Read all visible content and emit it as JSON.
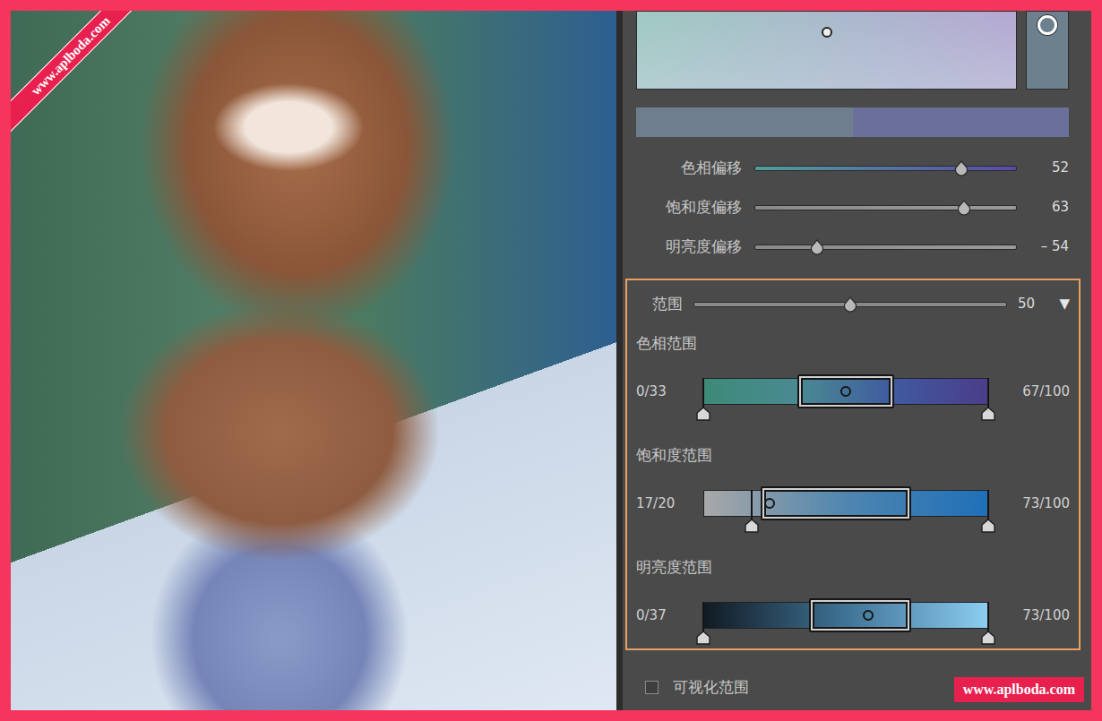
{
  "watermarks": [
    "www.aplboda.com",
    "www.aplboda.com"
  ],
  "color_picker": {
    "x": 0.5,
    "y": 0.27,
    "side_level": 0.18
  },
  "swatches": [
    {
      "color": "#6e7e8e"
    },
    {
      "color": "#6a6f9c"
    }
  ],
  "offsets": [
    {
      "label": "色相偏移",
      "value": "52",
      "level": 0.79,
      "colors": [
        "#4f9e9a",
        "#5a4aa8"
      ]
    },
    {
      "label": "饱和度偏移",
      "value": "63",
      "level": 0.8,
      "colors": [
        "#8a8a8a",
        "#9a9a9a"
      ]
    },
    {
      "label": "明亮度偏移",
      "value": "– 54",
      "level": 0.24,
      "colors": [
        "#8a8a8a",
        "#9a9a9a"
      ]
    }
  ],
  "range": {
    "label": "范围",
    "value": "50",
    "level": 0.5,
    "toggle": "▼",
    "expanded": true
  },
  "range_bars": [
    {
      "label": "色相范围",
      "left": "0/33",
      "right": "67/100",
      "low": 0,
      "high": 1,
      "start": 0.33,
      "end": 0.67,
      "dot": 0.5,
      "colors": [
        "#3d8a78",
        "#4a8a92",
        "#3f5aa0",
        "#4b3d8a"
      ]
    },
    {
      "label": "饱和度范围",
      "left": "17/20",
      "right": "73/100",
      "low": 0.17,
      "high": 1,
      "start": 0.2,
      "end": 0.73,
      "dot": 0.23,
      "colors": [
        "#a8a8a8",
        "#4f86b0",
        "#1f6fb8"
      ]
    },
    {
      "label": "明亮度范围",
      "left": "0/37",
      "right": "73/100",
      "low": 0,
      "high": 1,
      "start": 0.37,
      "end": 0.73,
      "dot": 0.58,
      "colors": [
        "#111a22",
        "#3f7396",
        "#8ccdf0"
      ]
    }
  ],
  "visualize": {
    "label": "可视化范围",
    "checked": false
  }
}
